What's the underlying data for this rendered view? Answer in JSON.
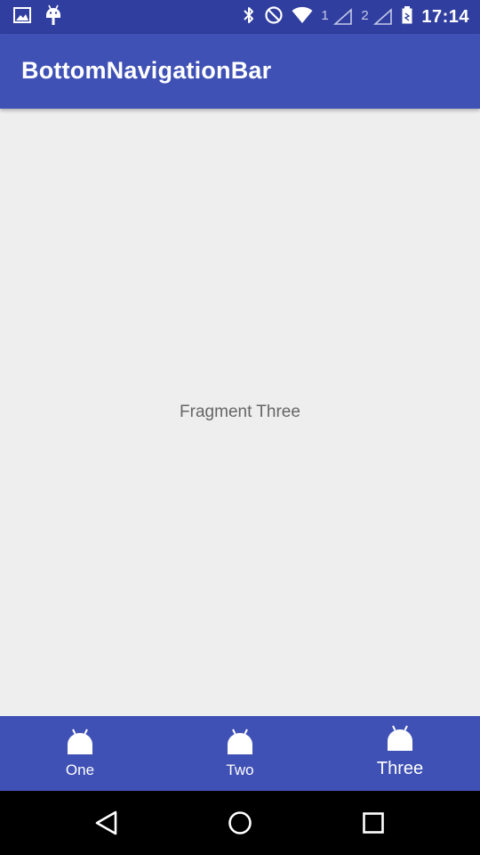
{
  "status_bar": {
    "time": "17:14",
    "sim1_label": "1",
    "sim2_label": "2",
    "icons": [
      "image-icon",
      "android-debug-icon",
      "bluetooth-icon",
      "do-not-disturb-icon",
      "wifi-icon",
      "signal-icon",
      "signal-icon",
      "battery-icon"
    ]
  },
  "app_bar": {
    "title": "BottomNavigationBar"
  },
  "content": {
    "fragment_text": "Fragment Three"
  },
  "bottom_nav": {
    "items": [
      {
        "label": "One",
        "icon": "android-icon",
        "active": false
      },
      {
        "label": "Two",
        "icon": "android-icon",
        "active": false
      },
      {
        "label": "Three",
        "icon": "android-icon",
        "active": true
      }
    ]
  },
  "system_nav": {
    "icons": [
      "back-icon",
      "home-icon",
      "recents-icon"
    ]
  },
  "colors": {
    "primary": "#3f51b5",
    "primary_dark": "#303f9f",
    "background": "#eeeeee",
    "text_secondary": "#666666"
  }
}
